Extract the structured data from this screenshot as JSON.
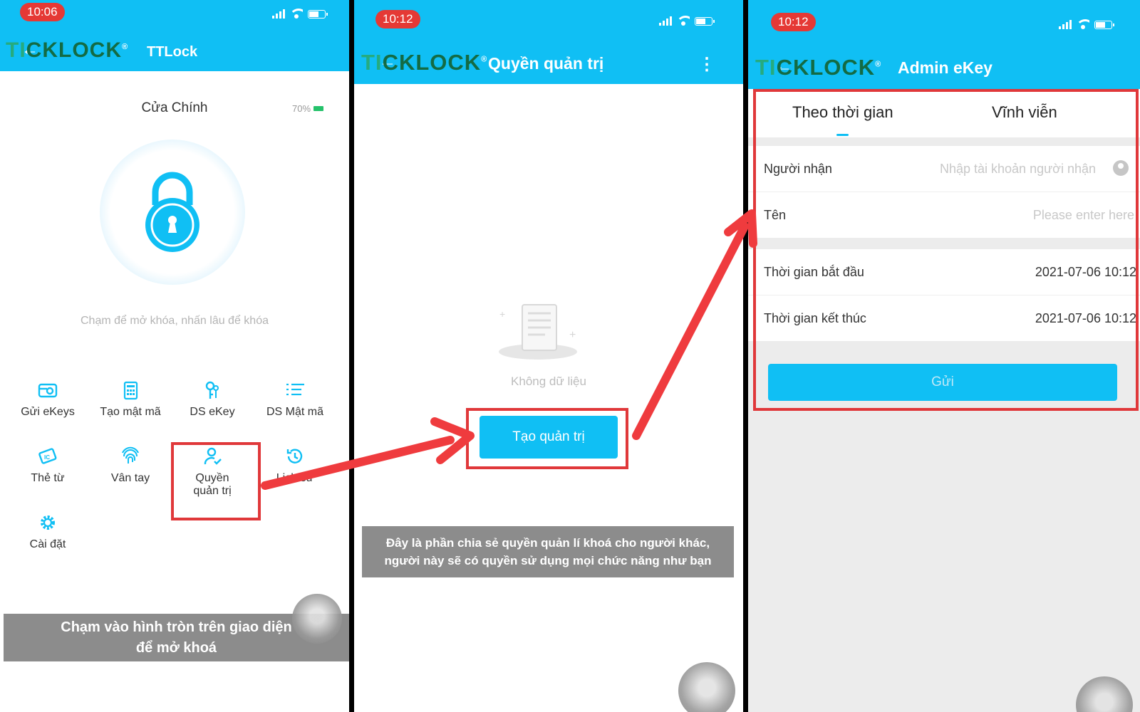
{
  "colors": {
    "header": "#10bff4",
    "highlight": "#e0383a",
    "arrow": "#ef3b3e"
  },
  "screen1": {
    "clock": "10:06",
    "logo": {
      "a": "TI",
      "b": "CKLOCK",
      "reg": "®"
    },
    "title": "TTLock",
    "lock_name": "Cửa Chính",
    "battery": "70%",
    "lock_icon": "padlock-icon",
    "hint": "Chạm để mở khóa, nhấn lâu để khóa",
    "menu": [
      {
        "label": "Gửi eKeys",
        "icon": "send-ekey-icon"
      },
      {
        "label": "Tạo mật mã",
        "icon": "keypad-icon"
      },
      {
        "label": "DS eKey",
        "icon": "keys-icon"
      },
      {
        "label": "DS Mật mã",
        "icon": "list-icon"
      },
      {
        "label": "Thẻ từ",
        "icon": "card-icon"
      },
      {
        "label": "Vân tay",
        "icon": "fingerprint-icon"
      },
      {
        "label": "Quyền quản trị",
        "label_line1": "Quyền",
        "label_line2": "quản trị",
        "icon": "admin-user-icon"
      },
      {
        "label": "Lịch sử",
        "icon": "history-icon"
      },
      {
        "label": "Cài đặt",
        "icon": "gear-icon"
      }
    ],
    "caption_line1": "Chạm vào hình tròn trên giao diện",
    "caption_line2": "để mở khoá"
  },
  "screen2": {
    "clock": "10:12",
    "logo": {
      "a": "TI",
      "b": "CKLOCK",
      "reg": "®"
    },
    "title": "Quyền quản trị",
    "more": "⋮",
    "empty_text": "Không dữ liệu",
    "create_button": "Tạo quản trị",
    "caption_line1": "Đây là phần chia sẻ quyền quản lí khoá cho người khác,",
    "caption_line2": "người này sẽ có quyền sử dụng mọi chức năng như bạn"
  },
  "screen3": {
    "clock": "10:12",
    "logo": {
      "a": "TI",
      "b": "CKLOCK",
      "reg": "®"
    },
    "title": "Admin eKey",
    "tabs": [
      "Theo thời gian",
      "Vĩnh viễn"
    ],
    "recipient_label": "Người nhận",
    "recipient_placeholder": "Nhập tài khoản người nhận",
    "name_label": "Tên",
    "name_placeholder": "Please enter here",
    "start_label": "Thời gian bắt đầu",
    "start_value": "2021-07-06 10:12",
    "end_label": "Thời gian kết thúc",
    "end_value": "2021-07-06 10:12",
    "send_button": "Gửi"
  }
}
